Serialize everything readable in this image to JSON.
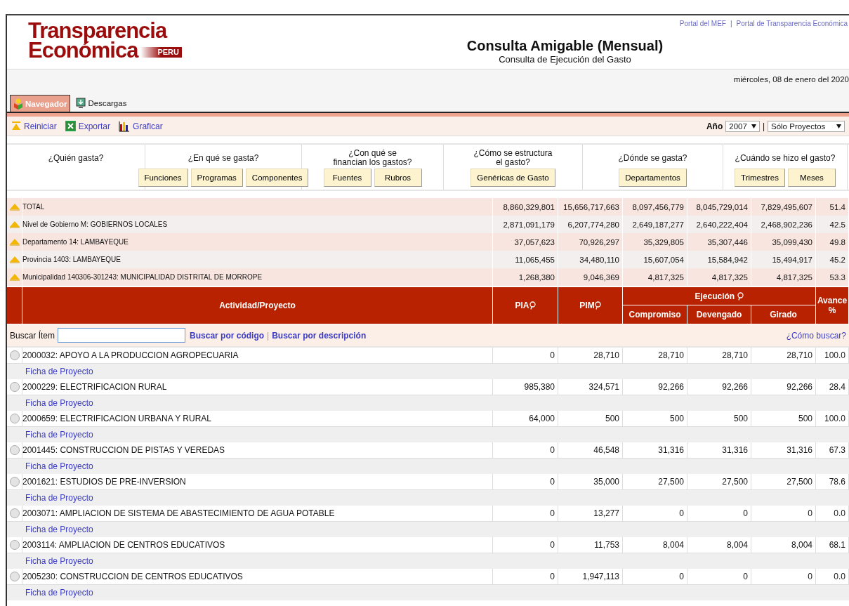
{
  "header": {
    "logo": {
      "line1": "Transparencia",
      "line2": "Económica",
      "badge": "PERU"
    },
    "title": "Consulta Amigable (Mensual)",
    "subtitle": "Consulta de Ejecución del Gasto",
    "links": [
      "Portal del MEF",
      "Portal de Transparencia Económica"
    ],
    "link_separator": "|",
    "date": "miércoles, 08 de enero del 2020"
  },
  "tabs": [
    {
      "label": "Navegador",
      "kind": "navigator",
      "selected": true
    },
    {
      "label": "Descargas",
      "kind": "downloads",
      "selected": false
    }
  ],
  "toolbar": {
    "actions": [
      {
        "label": "Reiniciar",
        "kind": "reset"
      },
      {
        "label": "Exportar",
        "kind": "excel"
      },
      {
        "label": "Graficar",
        "kind": "chart"
      }
    ],
    "year_label": "Año",
    "year": "2007",
    "separator": "|",
    "scope": "Sólo Proyectos"
  },
  "questions": [
    {
      "label": "¿Quién gasta?"
    },
    {
      "label": "¿En qué se gasta?",
      "buttons": [
        "Funciones",
        "Programas",
        "Componentes"
      ]
    },
    {
      "label": "¿Con qué se financian los gastos?",
      "buttons": [
        "Fuentes",
        "Rubros"
      ]
    },
    {
      "label": "¿Cómo se estructura el gasto?",
      "buttons": [
        "Genéricas de Gasto"
      ]
    },
    {
      "label": "¿Dónde se gasta?",
      "buttons": [
        "Departamentos"
      ]
    },
    {
      "label": "¿Cuándo se hizo el gasto?",
      "buttons": [
        "Trimestres",
        "Meses"
      ]
    }
  ],
  "summary": [
    {
      "label": "TOTAL",
      "pia": "8,860,329,801",
      "pim": "15,656,717,663",
      "compromiso": "8,097,456,779",
      "devengado": "8,045,729,014",
      "girado": "7,829,495,607",
      "avance": "51.4"
    },
    {
      "label": "Nivel de Gobierno M: GOBIERNOS LOCALES",
      "pia": "2,871,091,179",
      "pim": "6,207,774,280",
      "compromiso": "2,649,187,277",
      "devengado": "2,640,222,404",
      "girado": "2,468,902,236",
      "avance": "42.5"
    },
    {
      "label": "Departamento 14: LAMBAYEQUE",
      "pia": "37,057,623",
      "pim": "70,926,297",
      "compromiso": "35,329,805",
      "devengado": "35,307,446",
      "girado": "35,099,430",
      "avance": "49.8"
    },
    {
      "label": "Provincia 1403: LAMBAYEQUE",
      "pia": "11,065,455",
      "pim": "34,480,110",
      "compromiso": "15,607,054",
      "devengado": "15,584,942",
      "girado": "15,494,917",
      "avance": "45.2"
    },
    {
      "label": "Municipalidad 140306-301243: MUNICIPALIDAD DISTRITAL DE MORROPE",
      "pia": "1,268,380",
      "pim": "9,046,369",
      "compromiso": "4,817,325",
      "devengado": "4,817,325",
      "girado": "4,817,325",
      "avance": "53.3"
    }
  ],
  "table": {
    "columns": {
      "activity": "Actividad/Proyecto",
      "pia": "PIA",
      "pim": "PIM",
      "execution": "Ejecución",
      "compromiso": "Compromiso",
      "devengado": "Devengado",
      "girado": "Girado",
      "avance": "Avance %"
    },
    "search": {
      "label": "Buscar Ítem",
      "links": [
        "Buscar por código",
        "Buscar por descripción"
      ],
      "separator": "|",
      "help": "¿Cómo buscar?"
    },
    "rows": [
      {
        "name": "2000032: APOYO A LA PRODUCCION AGROPECUARIA",
        "link": "Ficha de Proyecto",
        "selected": false,
        "pia": "0",
        "pim": "28,710",
        "compromiso": "28,710",
        "devengado": "28,710",
        "girado": "28,710",
        "avance": "100.0"
      },
      {
        "name": "2000229: ELECTRIFICACION RURAL",
        "link": "Ficha de Proyecto",
        "selected": false,
        "pia": "985,380",
        "pim": "324,571",
        "compromiso": "92,266",
        "devengado": "92,266",
        "girado": "92,266",
        "avance": "28.4"
      },
      {
        "name": "2000659: ELECTRIFICACION URBANA Y RURAL",
        "link": "Ficha de Proyecto",
        "selected": false,
        "pia": "64,000",
        "pim": "500",
        "compromiso": "500",
        "devengado": "500",
        "girado": "500",
        "avance": "100.0"
      },
      {
        "name": "2001445: CONSTRUCCION DE PISTAS Y VEREDAS",
        "link": "Ficha de Proyecto",
        "selected": false,
        "pia": "0",
        "pim": "46,548",
        "compromiso": "31,316",
        "devengado": "31,316",
        "girado": "31,316",
        "avance": "67.3"
      },
      {
        "name": "2001621: ESTUDIOS DE PRE-INVERSION",
        "link": "Ficha de Proyecto",
        "selected": false,
        "pia": "0",
        "pim": "35,000",
        "compromiso": "27,500",
        "devengado": "27,500",
        "girado": "27,500",
        "avance": "78.6"
      },
      {
        "name": "2003071: AMPLIACION DE SISTEMA DE ABASTECIMIENTO DE AGUA POTABLE",
        "link": "Ficha de Proyecto",
        "selected": false,
        "pia": "0",
        "pim": "13,277",
        "compromiso": "0",
        "devengado": "0",
        "girado": "0",
        "avance": "0.0"
      },
      {
        "name": "2003114: AMPLIACION DE CENTROS EDUCATIVOS",
        "link": "Ficha de Proyecto",
        "selected": false,
        "pia": "0",
        "pim": "11,753",
        "compromiso": "8,004",
        "devengado": "8,004",
        "girado": "8,004",
        "avance": "68.1"
      },
      {
        "name": "2005230: CONSTRUCCION DE CENTROS EDUCATIVOS",
        "link": "Ficha de Proyecto",
        "selected": false,
        "pia": "0",
        "pim": "1,947,113",
        "compromiso": "0",
        "devengado": "0",
        "girado": "0",
        "avance": "0.0"
      }
    ]
  }
}
